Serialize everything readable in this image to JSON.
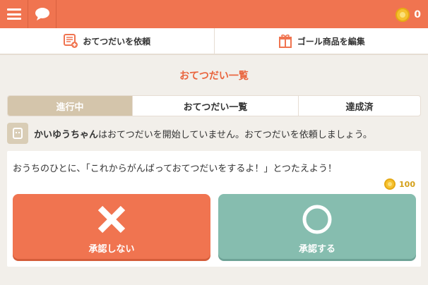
{
  "topbar": {
    "menu_icon": "menu-icon",
    "chat_icon": "chat-icon",
    "coin_count": "0"
  },
  "actions": {
    "request_label": "おてつだいを依頼",
    "edit_goals_label": "ゴール商品を編集"
  },
  "page_title": "おてつだい一覧",
  "tabs": [
    {
      "label": "進行中",
      "active": true
    },
    {
      "label": "おてつだい一覧",
      "active": false
    },
    {
      "label": "達成済",
      "active": false
    }
  ],
  "status": {
    "child_name": "かいゆうちゃん",
    "message": "はおてつだいを開始していません。おてつだいを依頼しましょう。"
  },
  "card": {
    "message": "おうちのひとに、「これからがんばっておてつだいをするよ！」とつたえよう！",
    "reward": "100",
    "reject_label": "承認しない",
    "approve_label": "承認する"
  },
  "colors": {
    "accent": "#f07450",
    "approve": "#86bdaf",
    "tab_active": "#d4c5ab",
    "title": "#e9643d"
  }
}
